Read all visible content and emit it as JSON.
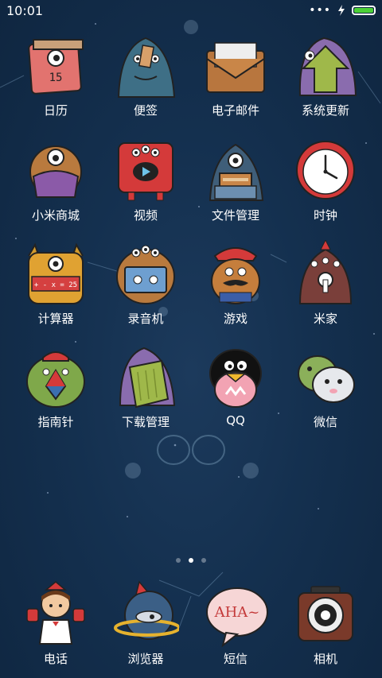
{
  "status_bar": {
    "time": "10:01",
    "battery_level": 1.0
  },
  "apps": [
    {
      "id": "calendar",
      "label": "日历",
      "icon": "calendar-icon"
    },
    {
      "id": "notes",
      "label": "便签",
      "icon": "notes-icon"
    },
    {
      "id": "email",
      "label": "电子邮件",
      "icon": "email-icon"
    },
    {
      "id": "updater",
      "label": "系统更新",
      "icon": "update-icon"
    },
    {
      "id": "mi-store",
      "label": "小米商城",
      "icon": "store-icon"
    },
    {
      "id": "video",
      "label": "视频",
      "icon": "video-icon"
    },
    {
      "id": "file-manager",
      "label": "文件管理",
      "icon": "folder-icon"
    },
    {
      "id": "clock",
      "label": "时钟",
      "icon": "clock-icon"
    },
    {
      "id": "calculator",
      "label": "计算器",
      "icon": "calculator-icon"
    },
    {
      "id": "recorder",
      "label": "录音机",
      "icon": "recorder-icon"
    },
    {
      "id": "games",
      "label": "游戏",
      "icon": "game-icon"
    },
    {
      "id": "mijia",
      "label": "米家",
      "icon": "mijia-icon"
    },
    {
      "id": "compass",
      "label": "指南针",
      "icon": "compass-icon"
    },
    {
      "id": "downloads",
      "label": "下载管理",
      "icon": "download-icon"
    },
    {
      "id": "qq",
      "label": "QQ",
      "icon": "qq-icon"
    },
    {
      "id": "wechat",
      "label": "微信",
      "icon": "wechat-icon"
    }
  ],
  "icon_text": {
    "calendar_number": "15",
    "calculator_display": "+ - x = 25",
    "browser_speech": "AHA~"
  },
  "page_indicator": {
    "count": 3,
    "active": 1
  },
  "dock": [
    {
      "id": "phone",
      "label": "电话",
      "icon": "phone-icon"
    },
    {
      "id": "browser",
      "label": "浏览器",
      "icon": "browser-icon"
    },
    {
      "id": "messages",
      "label": "短信",
      "icon": "messages-icon"
    },
    {
      "id": "camera",
      "label": "相机",
      "icon": "camera-icon"
    }
  ]
}
